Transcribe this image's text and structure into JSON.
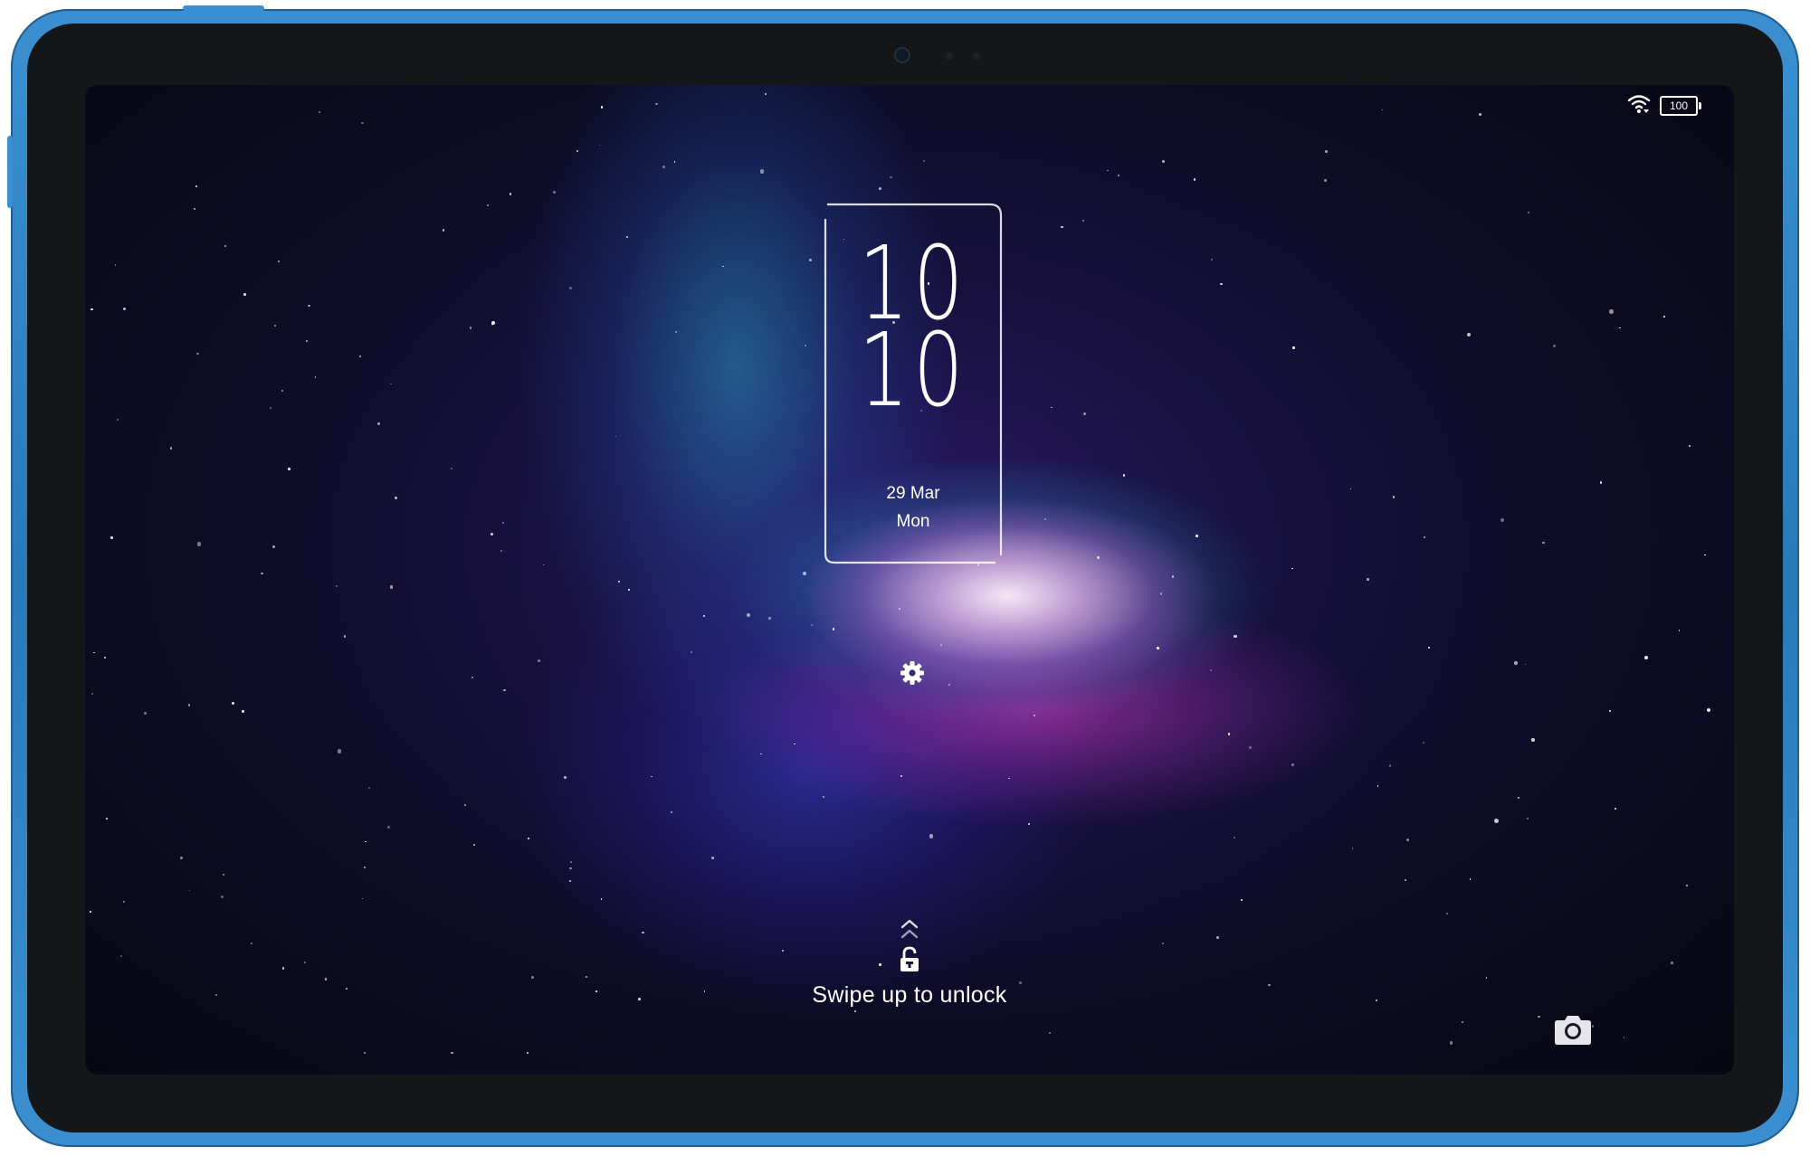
{
  "status_bar": {
    "wifi_icon": "wifi-icon",
    "battery_level": "100"
  },
  "clock": {
    "hours": "10",
    "minutes": "10",
    "date": "29 Mar",
    "weekday": "Mon"
  },
  "lockscreen": {
    "settings_icon": "gear-icon",
    "chevron_icon": "chevron-up-double-icon",
    "lock_icon": "lock-icon",
    "swipe_text": "Swipe up to unlock",
    "camera_icon": "camera-icon"
  },
  "colors": {
    "device_frame": "#3b8fd0",
    "bezel": "#141618",
    "text": "#ffffff"
  }
}
